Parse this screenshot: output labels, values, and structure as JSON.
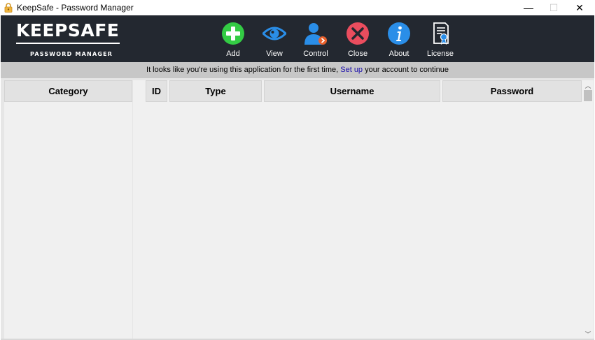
{
  "window": {
    "title": "KeepSafe - Password Manager",
    "minimize_glyph": "—",
    "maximize_glyph": "☐",
    "close_glyph": "✕"
  },
  "logo": {
    "main": "KEEPSAFE",
    "sub": "PASSWORD MANAGER"
  },
  "toolbar": [
    {
      "label": "Add",
      "icon": "plus-circle-icon",
      "color": "#2ecc40"
    },
    {
      "label": "View",
      "icon": "eye-icon",
      "color": "#1e88e5"
    },
    {
      "label": "Control",
      "icon": "user-control-icon",
      "color": "#1e88e5"
    },
    {
      "label": "Close",
      "icon": "close-circle-icon",
      "color": "#e94a5b"
    },
    {
      "label": "About",
      "icon": "info-circle-icon",
      "color": "#1e88e5"
    },
    {
      "label": "License",
      "icon": "certificate-icon",
      "color": "#ffffff"
    }
  ],
  "notice": {
    "before": "It looks like you're using this application for the first time,",
    "link": "Set up",
    "after": "your account to continue"
  },
  "category_panel": {
    "header": "Category"
  },
  "table": {
    "columns": [
      "ID",
      "Type",
      "Username",
      "Password"
    ],
    "rows": []
  },
  "colors": {
    "header_bg": "#232830",
    "notice_bg": "#c7c7c7",
    "link": "#1a0dab"
  }
}
